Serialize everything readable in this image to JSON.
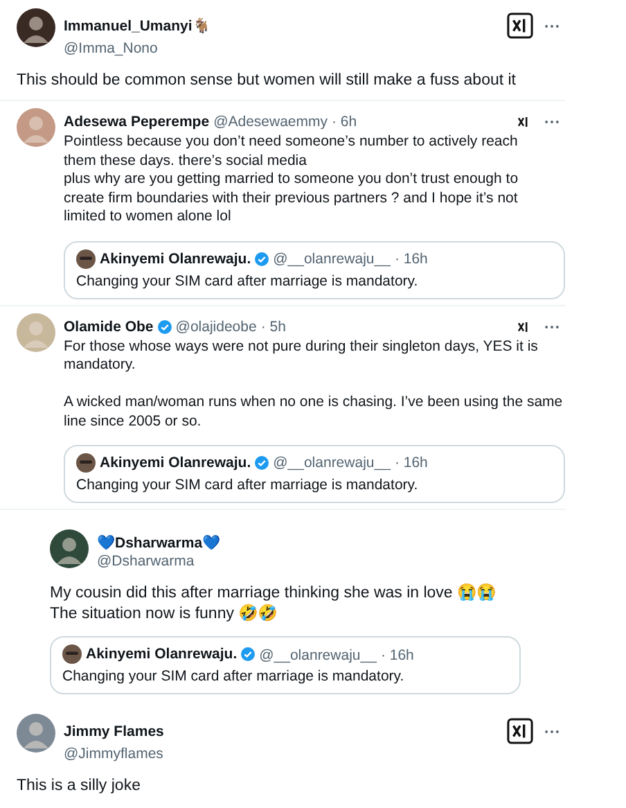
{
  "tweets": [
    {
      "kind": "stacked",
      "author": "Immanuel_Umanyi🐐",
      "verified": false,
      "handle": "@Imma_Nono",
      "logo_boxed": true,
      "text": "This should be common sense but women will still make a fuss about it"
    },
    {
      "kind": "inline",
      "author": "Adesewa Peperempe",
      "verified": false,
      "handle": "@Adesewaemmy",
      "time": "· 6h",
      "logo_boxed": false,
      "text": "Pointless because you don’t need someone’s number to actively reach them these days. there’s social media\nplus why are you getting married to someone you don’t trust enough to create firm boundaries with their previous partners ? and I hope it’s not limited to women alone lol",
      "quote": {
        "author": "Akinyemi Olanrewaju.",
        "verified": true,
        "handle": "@__olanrewaju__",
        "time": "· 16h",
        "text": "Changing your SIM card after marriage is mandatory."
      }
    },
    {
      "kind": "inline",
      "author": "Olamide Obe",
      "verified": true,
      "handle": "@olajideobe",
      "time": "· 5h",
      "logo_boxed": false,
      "text": "For those whose ways were not pure during their singleton days, YES it is mandatory.\n\nA wicked man/woman runs when no one is chasing. I’ve been using the same line since 2005 or so.",
      "quote": {
        "author": "Akinyemi Olanrewaju.",
        "verified": true,
        "handle": "@__olanrewaju__",
        "time": "· 16h",
        "text": "Changing your SIM card after marriage is mandatory."
      }
    },
    {
      "kind": "stacked",
      "author": "💙Dsharwarma💙",
      "verified": false,
      "handle": "@Dsharwarma",
      "text": "My cousin did this after marriage thinking she was in love 😭😭\nThe situation now is funny 🤣🤣",
      "quote": {
        "author": "Akinyemi Olanrewaju.",
        "verified": true,
        "handle": "@__olanrewaju__",
        "time": "· 16h",
        "text": "Changing your SIM card after marriage is mandatory."
      }
    },
    {
      "kind": "stacked",
      "author": "Jimmy Flames",
      "verified": false,
      "handle": "@Jimmyflames",
      "logo_boxed": true,
      "text": "This is a silly joke"
    }
  ]
}
